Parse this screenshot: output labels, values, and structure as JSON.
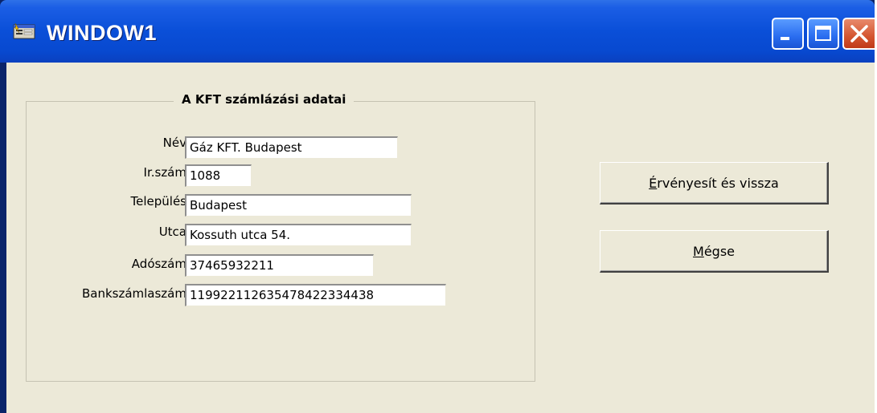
{
  "window": {
    "title": "WINDOW1",
    "icon": "app-form-icon",
    "controls": {
      "minimize": "minimize-icon",
      "maximize": "maximize-icon",
      "close": "close-icon"
    }
  },
  "group": {
    "title": "A KFT számlázási adatai",
    "fields": [
      {
        "label": "Név",
        "value": "Gáz KFT. Budapest"
      },
      {
        "label": "Ir.szám",
        "value": "1088"
      },
      {
        "label": "Település",
        "value": "Budapest"
      },
      {
        "label": "Utca",
        "value": "Kossuth utca 54."
      },
      {
        "label": "Adószám",
        "value": "37465932211"
      },
      {
        "label": "Bankszámlaszám",
        "value": "119922112635478422334438"
      }
    ]
  },
  "buttons": {
    "ok": {
      "mnemonic": "É",
      "rest": "rvényesít és vissza"
    },
    "cancel": {
      "mnemonic": "M",
      "rest": "égse"
    }
  },
  "colors": {
    "titlebar": "#0a4fd8",
    "client": "#ece9d8",
    "close_button": "#d45530"
  }
}
